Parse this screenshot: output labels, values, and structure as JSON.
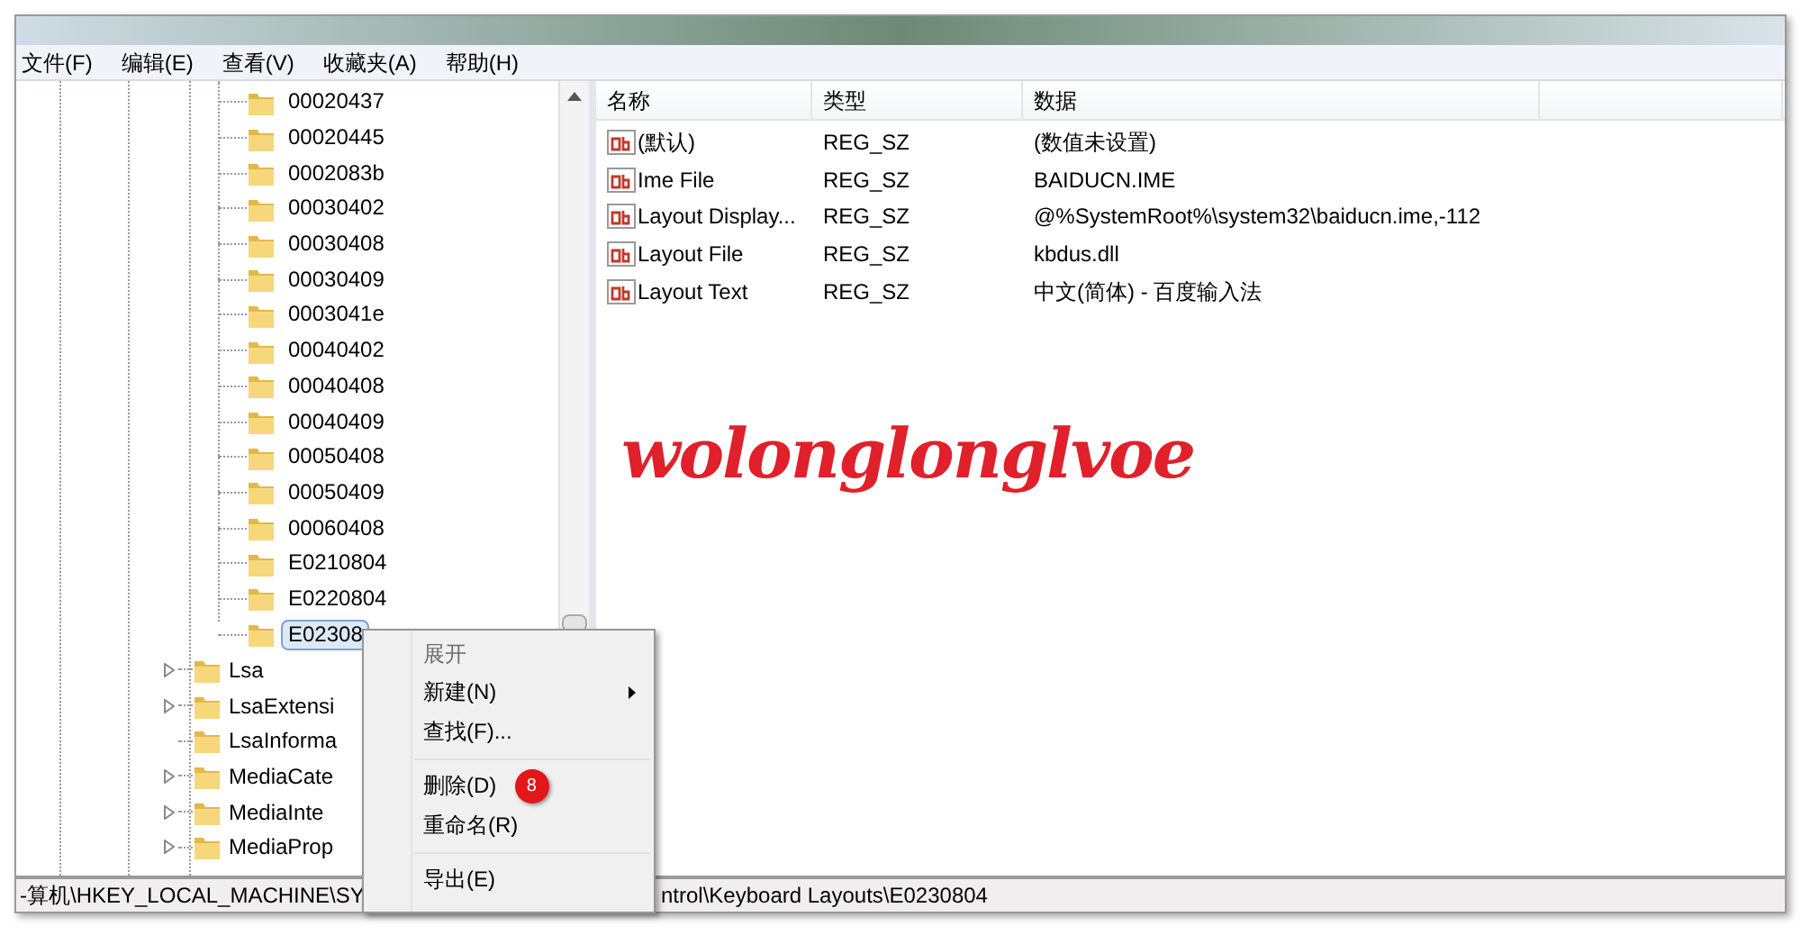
{
  "menu_bar": [
    "文件(F)",
    "编辑(E)",
    "查看(V)",
    "收藏夹(A)",
    "帮助(H)"
  ],
  "tree": {
    "nested_keys": [
      {
        "label": "00020437",
        "selected": false
      },
      {
        "label": "00020445",
        "selected": false
      },
      {
        "label": "0002083b",
        "selected": false
      },
      {
        "label": "00030402",
        "selected": false
      },
      {
        "label": "00030408",
        "selected": false
      },
      {
        "label": "00030409",
        "selected": false
      },
      {
        "label": "0003041e",
        "selected": false
      },
      {
        "label": "00040402",
        "selected": false
      },
      {
        "label": "00040408",
        "selected": false
      },
      {
        "label": "00040409",
        "selected": false
      },
      {
        "label": "00050408",
        "selected": false
      },
      {
        "label": "00050409",
        "selected": false
      },
      {
        "label": "00060408",
        "selected": false
      },
      {
        "label": "E0210804",
        "selected": false
      },
      {
        "label": "E0220804",
        "selected": false
      },
      {
        "label": "E02308",
        "selected": true
      }
    ],
    "keys": [
      {
        "label": "Lsa",
        "has_children": true
      },
      {
        "label": "LsaExtensi",
        "has_children": true
      },
      {
        "label": "LsaInforma",
        "has_children": false
      },
      {
        "label": "MediaCate",
        "has_children": true
      },
      {
        "label": "MediaInte",
        "has_children": true
      },
      {
        "label": "MediaProp",
        "has_children": true
      }
    ]
  },
  "table": {
    "columns": [
      "名称",
      "类型",
      "数据"
    ],
    "rows": [
      {
        "name": "(默认)",
        "type": "REG_SZ",
        "data": "(数值未设置)"
      },
      {
        "name": "Ime File",
        "type": "REG_SZ",
        "data": "BAIDUCN.IME"
      },
      {
        "name": "Layout Display...",
        "type": "REG_SZ",
        "data": "@%SystemRoot%\\system32\\baiducn.ime,-112"
      },
      {
        "name": "Layout File",
        "type": "REG_SZ",
        "data": "kbdus.dll"
      },
      {
        "name": "Layout Text",
        "type": "REG_SZ",
        "data": "中文(简体) - 百度输入法"
      }
    ]
  },
  "signature": "wolonglonglvoe",
  "context_menu": [
    {
      "kind": "item",
      "label": "展开",
      "disabled": true,
      "submenu": false
    },
    {
      "kind": "item",
      "label": "新建(N)",
      "disabled": false,
      "submenu": true
    },
    {
      "kind": "item",
      "label": "查找(F)...",
      "disabled": false,
      "submenu": false
    },
    {
      "kind": "separator"
    },
    {
      "kind": "item",
      "label": "删除(D)",
      "disabled": false,
      "submenu": false,
      "step_badge": "8"
    },
    {
      "kind": "item",
      "label": "重命名(R)",
      "disabled": false,
      "submenu": false
    },
    {
      "kind": "separator"
    },
    {
      "kind": "item",
      "label": "导出(E)",
      "disabled": false,
      "submenu": false
    }
  ],
  "status_bar": {
    "left": "-算机\\HKEY_LOCAL_MACHINE\\SY",
    "right": "ntrol\\Keyboard Layouts\\E0230804"
  }
}
